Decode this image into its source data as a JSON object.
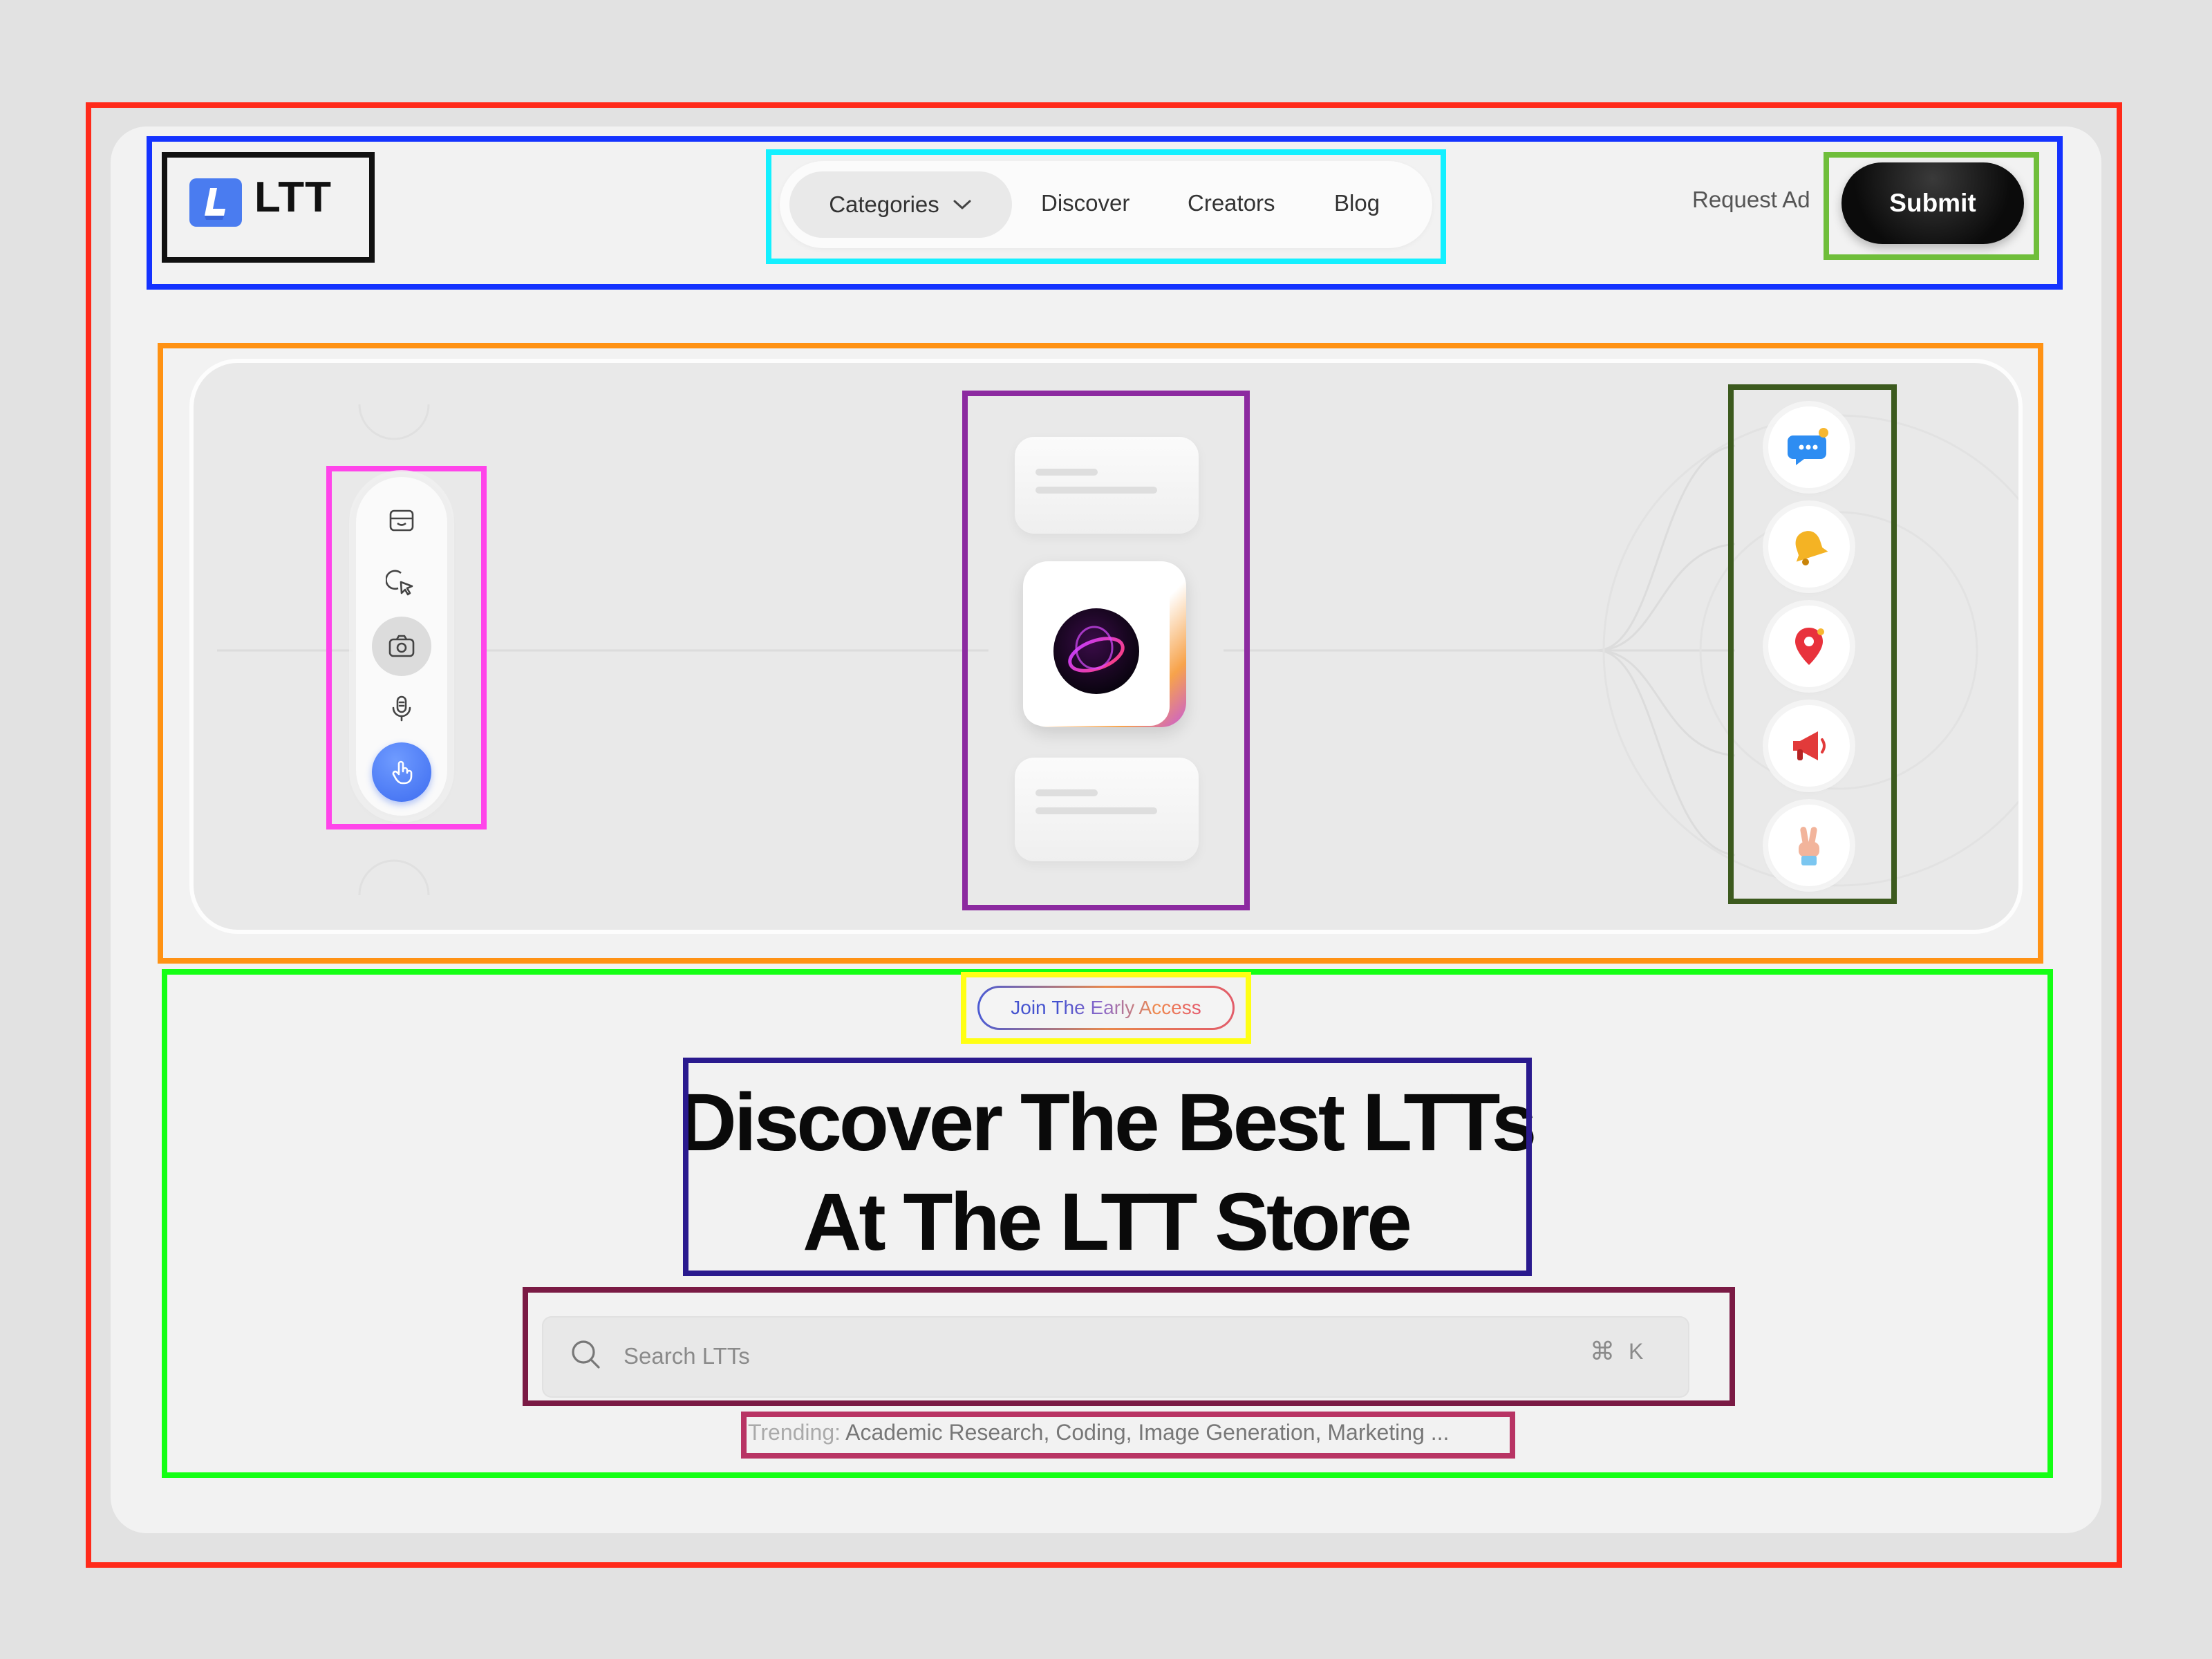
{
  "brand": {
    "name": "LTT",
    "logo_letter": "L",
    "accent": "#4a7cf0"
  },
  "nav": {
    "categories": "Categories",
    "links": [
      "Discover",
      "Creators",
      "Blog"
    ]
  },
  "header_actions": {
    "request_ad": "Request Ad",
    "submit": "Submit"
  },
  "toolbar": {
    "icons": [
      "inbox-icon",
      "cursor-click-icon",
      "camera-icon",
      "microphone-icon",
      "tap-gesture-icon"
    ],
    "active": "camera-icon"
  },
  "reactions": [
    "chat-bubble-icon",
    "bell-icon",
    "location-pin-icon",
    "megaphone-icon",
    "peace-hand-icon"
  ],
  "hero": {
    "badge_join": "Join",
    "badge_rest": "The Early Access",
    "headline_line1": "Discover The Best LTTs",
    "headline_line2": "At The LTT Store"
  },
  "search": {
    "placeholder": "Search LTTs",
    "shortcut_symbol": "⌘",
    "shortcut_key": "K"
  },
  "trending": {
    "label": "Trending:",
    "items": "Academic Research, Coding, Image Generation, Marketing ..."
  }
}
